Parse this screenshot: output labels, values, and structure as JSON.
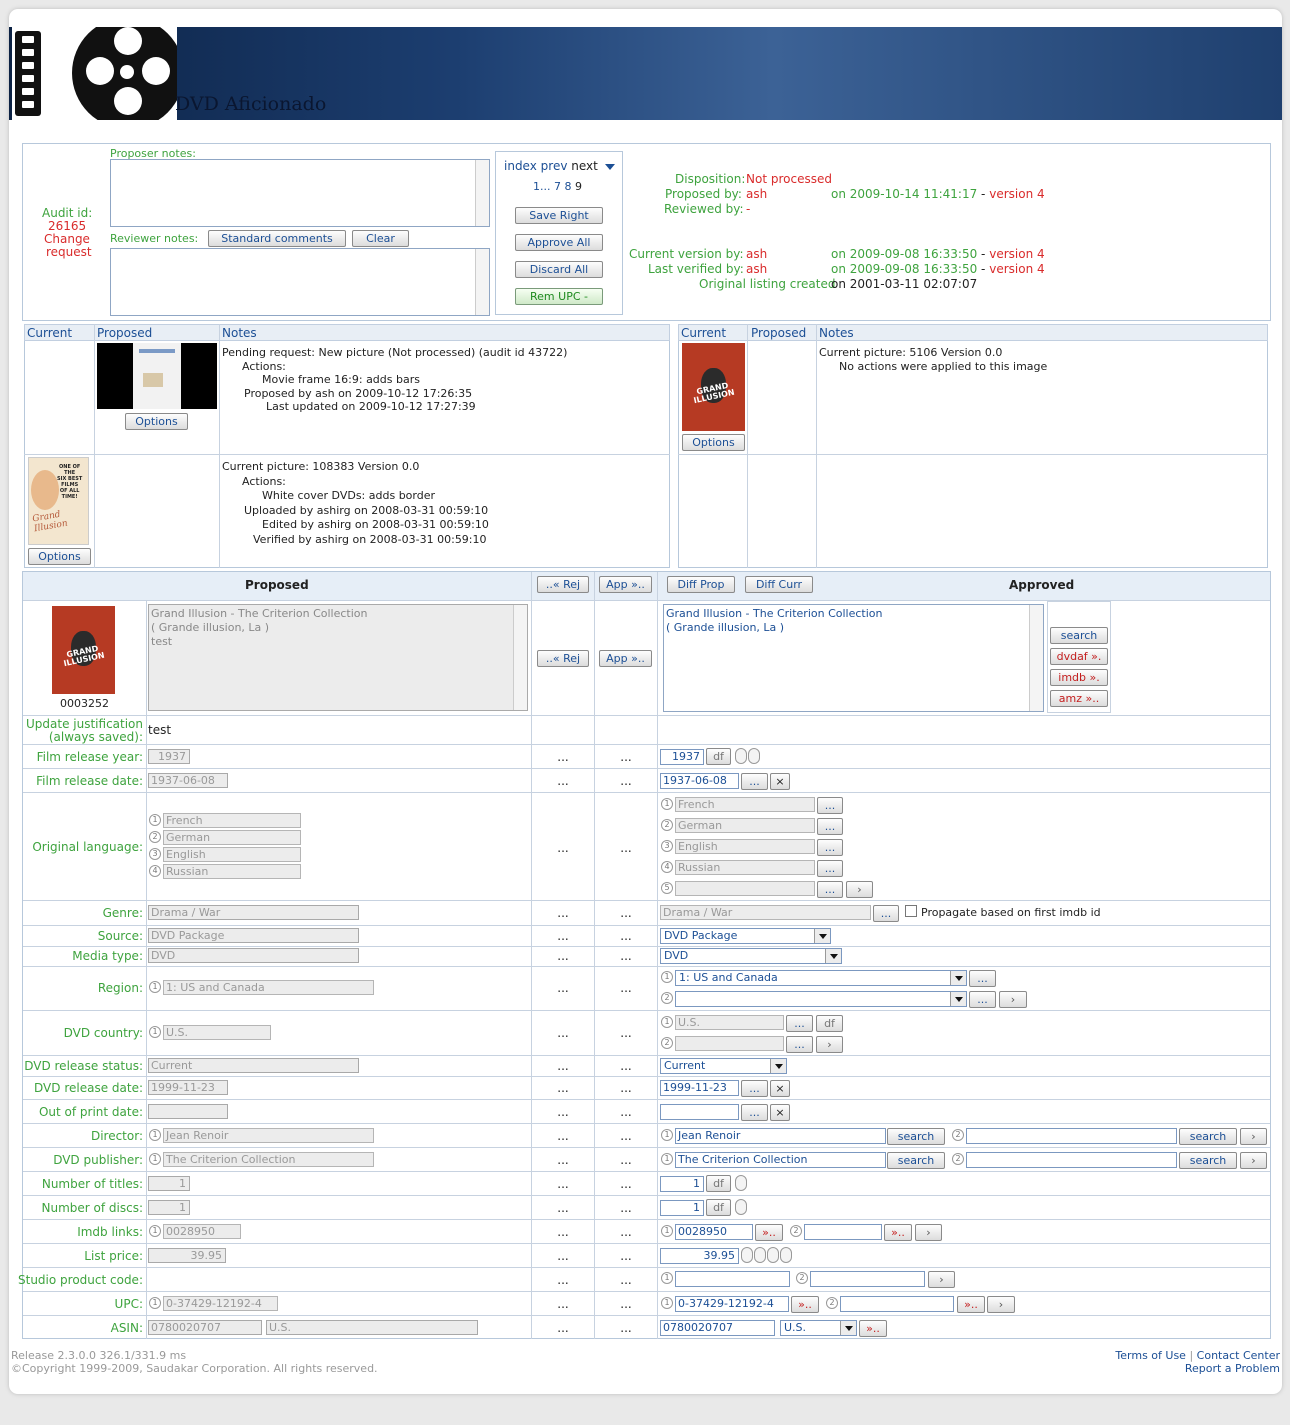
{
  "site": {
    "title": "DVD Aficionado"
  },
  "audit": {
    "audit_id_label": "Audit id:",
    "audit_id": "26165",
    "type_line1": "Change",
    "type_line2": "request"
  },
  "notes": {
    "proposer_label": "Proposer notes:",
    "reviewer_label": "Reviewer notes:",
    "standard_comments": "Standard comments",
    "clear": "Clear"
  },
  "nav": {
    "index": "index",
    "prev": "prev",
    "next": "next",
    "pages_prefix": "1...",
    "page7": "7",
    "page8": "8",
    "page9": "9"
  },
  "actions": {
    "save_right": "Save Right",
    "approve_all": "Approve All",
    "discard_all": "Discard All",
    "rem_upc": "Rem UPC -"
  },
  "status": {
    "disposition_label": "Disposition:",
    "disposition": "Not processed",
    "proposed_by_label": "Proposed by:",
    "proposed_by": "ash",
    "proposed_on": "on 2009-10-14 11:41:17",
    "proposed_version": "version 4",
    "reviewed_by_label": "Reviewed by:",
    "reviewed_by": "-",
    "current_version_label": "Current version by:",
    "current_version_by": "ash",
    "current_version_on": "on 2009-09-08 16:33:50",
    "current_version_version": "version 4",
    "last_verified_label": "Last verified by:",
    "last_verified_by": "ash",
    "last_verified_on": "on 2009-09-08 16:33:50",
    "last_verified_version": "version 4",
    "original_label": "Original listing created",
    "original_on": "on 2001-03-11 02:07:07",
    "dash": "-"
  },
  "pictures": {
    "headers": {
      "current": "Current",
      "proposed": "Proposed",
      "notes": "Notes"
    },
    "options": "Options",
    "left_row1_notes": [
      "Pending request: New picture (Not processed) (audit id 43722)",
      "Actions:",
      "Movie frame 16:9: adds bars",
      "Proposed by ash on 2009-10-12 17:26:35",
      "Last updated on 2009-10-12 17:27:39"
    ],
    "left_row2_notes": [
      "Current picture: 108383    Version 0.0",
      "Actions:",
      "White cover DVDs: adds border",
      "Uploaded by ashirg on 2008-03-31 00:59:10",
      "Edited by ashirg on 2008-03-31 00:59:10",
      "Verified by ashirg on 2008-03-31 00:59:10"
    ],
    "right_row1_notes": [
      "Current picture: 5106    Version 0.0",
      "No actions were applied to this image"
    ],
    "poster_title": "GRAND ILLUSION",
    "old_cover_lines": [
      "ONE OF",
      "THE",
      "SIX BEST",
      "FILMS",
      "OF ALL",
      "TIME!"
    ],
    "old_cover_title": "Grand Illusion"
  },
  "compare": {
    "proposed_header": "Proposed",
    "approved_header": "Approved",
    "rej": "..« Rej",
    "app": "App »..",
    "diff_prop": "Diff Prop",
    "diff_curr": "Diff Curr",
    "cover_id": "0003252",
    "proposed_title": [
      "Grand Illusion - The Criterion Collection",
      "( Grande illusion, La )",
      "test"
    ],
    "approved_title": [
      "Grand Illusion - The Criterion Collection",
      "( Grande illusion, La )"
    ],
    "search": "search",
    "dvdaf": "dvdaf ».",
    "imdb": "imdb ».",
    "amz": "amz »..",
    "dots": "...",
    "df": "df",
    "dotbtn": "...",
    "x": "×",
    "arrow": "›",
    "red_arrow": "»..",
    "propagate_label": "Propagate based on first imdb id"
  },
  "fields": {
    "update_justification_label1": "Update justification",
    "update_justification_label2": "(always saved):",
    "update_justification": "test",
    "film_year_label": "Film release year:",
    "film_year": "1937",
    "film_date_label": "Film release date:",
    "film_date": "1937-06-08",
    "orig_lang_label": "Original language:",
    "languages": [
      "French",
      "German",
      "English",
      "Russian"
    ],
    "nums": [
      "1",
      "2",
      "3",
      "4",
      "5"
    ],
    "genre_label": "Genre:",
    "genre": "Drama / War",
    "source_label": "Source:",
    "source": "DVD Package",
    "media_label": "Media type:",
    "media": "DVD",
    "region_label": "Region:",
    "region": "1: US and Canada",
    "country_label": "DVD country:",
    "country": "U.S.",
    "release_status_label": "DVD release status:",
    "release_status": "Current",
    "dvd_date_label": "DVD release date:",
    "dvd_date": "1999-11-23",
    "oop_label": "Out of print date:",
    "director_label": "Director:",
    "director": "Jean Renoir",
    "publisher_label": "DVD publisher:",
    "publisher": "The Criterion Collection",
    "titles_label": "Number of titles:",
    "titles": "1",
    "discs_label": "Number of discs:",
    "discs": "1",
    "imdb_label": "Imdb links:",
    "imdb": "0028950",
    "price_label": "List price:",
    "price": "39.95",
    "studio_label": "Studio product code:",
    "upc_label": "UPC:",
    "upc": "0-37429-12192-4",
    "asin_label": "ASIN:",
    "asin": "0780020707",
    "asin_country": "U.S."
  },
  "footer": {
    "release": "Release 2.3.0.0    326.1/331.9 ms",
    "copyright": "©Copyright 1999-2009, Saudakar Corporation. All rights reserved.",
    "terms": "Terms of Use",
    "sep": "|",
    "contact": "Contact Center",
    "report": "Report a Problem"
  }
}
